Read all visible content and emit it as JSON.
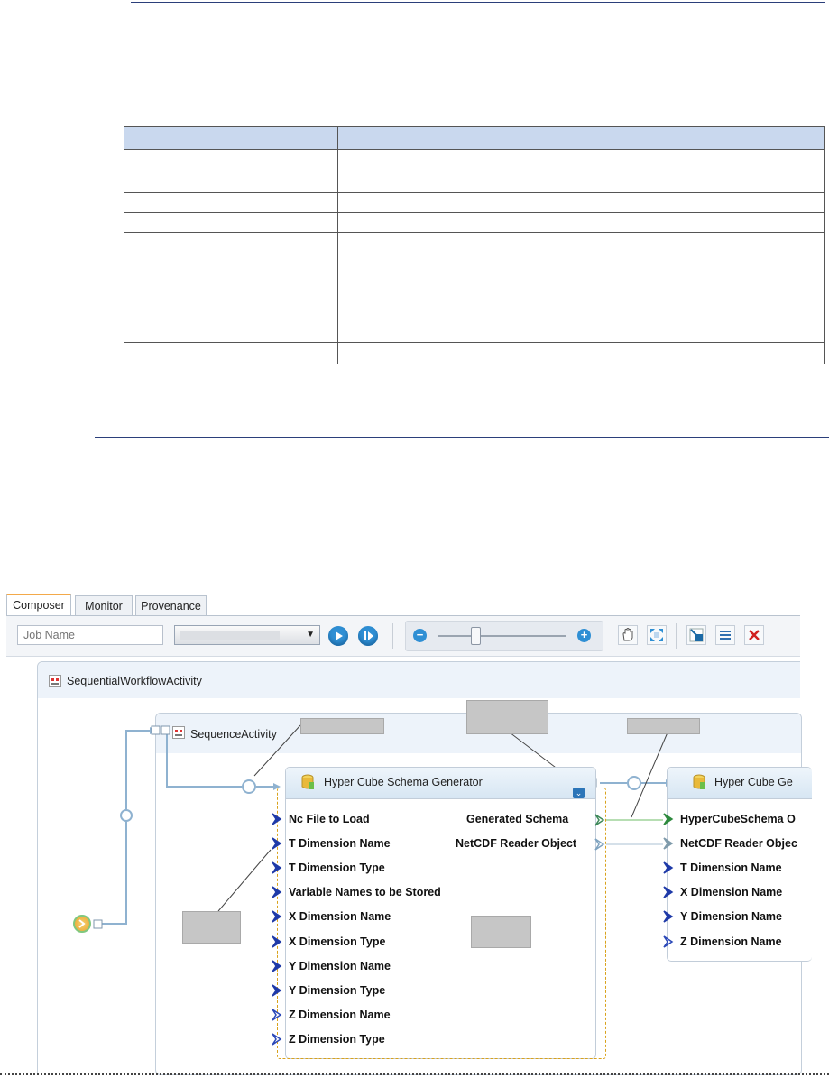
{
  "composer": {
    "tabs": [
      "Composer",
      "Monitor",
      "Provenance"
    ],
    "job_name_placeholder": "Job Name",
    "workflow_title": "SequentialWorkflowActivity",
    "sequence_title": "SequenceActivity",
    "activity1": {
      "title": "Hyper Cube Schema Generator",
      "inputs": [
        "Nc File to Load",
        "T Dimension Name",
        "T Dimension Type",
        "Variable Names to be Stored",
        "X Dimension Name",
        "X Dimension Type",
        "Y Dimension Name",
        "Y Dimension Type",
        "Z Dimension Name",
        "Z Dimension Type"
      ],
      "outputs": [
        "Generated Schema",
        "NetCDF Reader Object"
      ]
    },
    "activity2": {
      "title": "Hyper Cube Ge",
      "inputs": [
        "HyperCubeSchema O",
        "NetCDF Reader Objec",
        "T Dimension Name",
        "X Dimension Name",
        "Y Dimension Name",
        "Z Dimension Name"
      ]
    },
    "icons": [
      "play-icon",
      "step-icon",
      "zoom-out-icon",
      "zoom-in-icon",
      "pan-hand-icon",
      "fit-icon",
      "expand-icon",
      "list-icon",
      "close-icon",
      "sequence-icon",
      "database-icon"
    ],
    "colors": {
      "accent": "#2f8fd4",
      "selection": "#d9a21c",
      "port_filled": "#1f3aa8",
      "connector": "#8fb2d0"
    }
  }
}
